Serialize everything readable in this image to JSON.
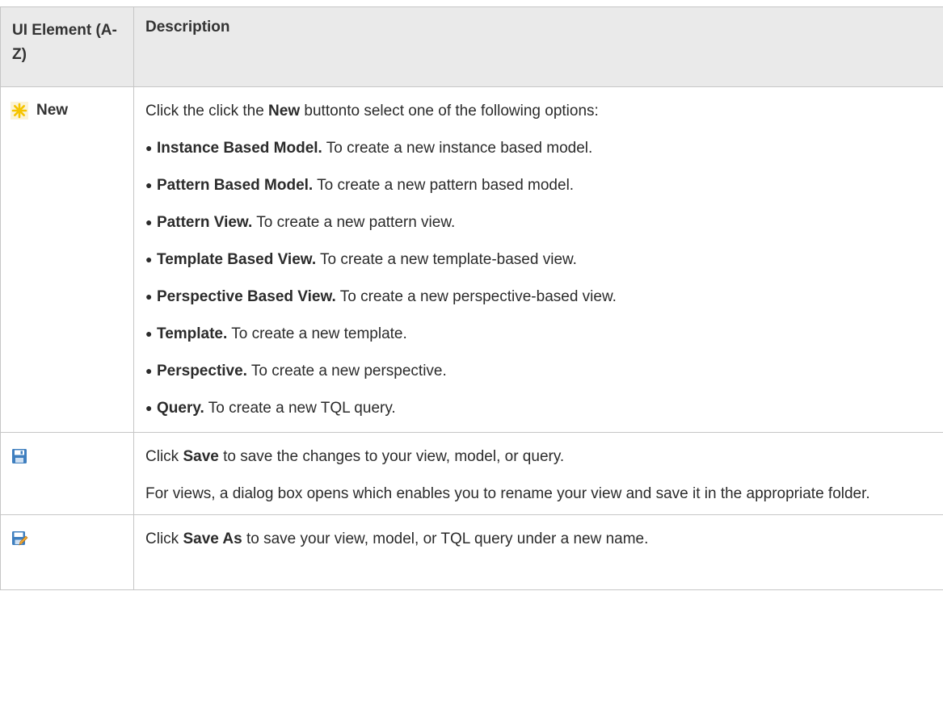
{
  "table": {
    "headers": {
      "element": "UI Element (A-Z)",
      "description": "Description"
    },
    "rows": [
      {
        "element_label": "New",
        "icon": "new-star-icon",
        "intro": {
          "pre": "Click the click the ",
          "bold": "New",
          "post": " buttonto select one of the following options:"
        },
        "options": [
          {
            "bold": "Instance Based Model.",
            "text": " To create a new instance based model."
          },
          {
            "bold": "Pattern Based Model.",
            "text": " To create a new pattern based model."
          },
          {
            "bold": "Pattern View.",
            "text": " To create a new pattern view."
          },
          {
            "bold": "Template Based View.",
            "text": " To create a new template-based view."
          },
          {
            "bold": "Perspective Based View.",
            "text": " To create a new perspective-based view."
          },
          {
            "bold": "Template.",
            "text": " To create a new template."
          },
          {
            "bold": "Perspective.",
            "text": " To create a new perspective."
          },
          {
            "bold": "Query.",
            "text": " To create a new TQL query."
          }
        ]
      },
      {
        "icon": "save-floppy-icon",
        "line1": {
          "pre": "Click ",
          "bold": "Save",
          "post": " to save the changes to your view, model, or query."
        },
        "line2": "For views, a dialog box opens which enables you to rename your view and save it in the appropriate folder."
      },
      {
        "icon": "save-as-icon",
        "line1": {
          "pre": "Click ",
          "bold": "Save As",
          "post": " to save your view, model, or TQL query under a new name."
        }
      }
    ]
  },
  "colors": {
    "header_bg": "#eaeaea",
    "border": "#c6c6c6",
    "star": "#f5c400",
    "floppy": "#3f7fbf"
  }
}
